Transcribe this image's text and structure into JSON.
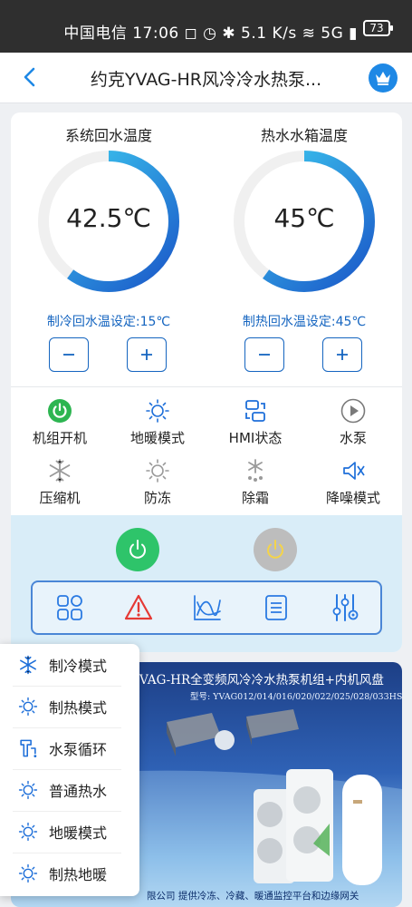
{
  "status_bar": {
    "text": "中国电信 17:06 ◻ ◷ ✱ 5.1 K/s ≋ 5G ▮",
    "battery": "73"
  },
  "header": {
    "title": "约克YVAG-HR风冷冷水热泵...",
    "back_icon": "chevron-left-icon",
    "vip_icon": "crown-icon"
  },
  "gauges": [
    {
      "label": "系统回水温度",
      "value": "42.5℃",
      "level": 0.6,
      "setpoint": "制冷回水温设定:15℃"
    },
    {
      "label": "热水水箱温度",
      "value": "45℃",
      "level": 0.6,
      "setpoint": "制热回水温设定:45℃"
    }
  ],
  "stepper": {
    "minus": "−",
    "plus": "+"
  },
  "status_items": [
    {
      "label": "机组开机",
      "icon": "power-on-icon",
      "color": "#2db551"
    },
    {
      "label": "地暖模式",
      "icon": "sun-icon",
      "color": "#1e6fd9"
    },
    {
      "label": "HMI状态",
      "icon": "hmi-icon",
      "color": "#1e6fd9"
    },
    {
      "label": "水泵",
      "icon": "play-icon",
      "color": "#7a7a7a"
    },
    {
      "label": "压缩机",
      "icon": "snowflake-icon",
      "color": "#9a9a9a"
    },
    {
      "label": "防冻",
      "icon": "sun-icon",
      "color": "#9a9a9a"
    },
    {
      "label": "除霜",
      "icon": "defrost-icon",
      "color": "#9a9a9a"
    },
    {
      "label": "降噪模式",
      "icon": "mute-icon",
      "color": "#1e6fd9"
    }
  ],
  "power_buttons": [
    {
      "icon": "power-icon",
      "color": "#2ec46a"
    },
    {
      "icon": "power-icon",
      "color": "#bdbdbd"
    }
  ],
  "toolbar": [
    {
      "icon": "grid-icon",
      "color": "#2a7ae2"
    },
    {
      "icon": "alarm-icon",
      "color": "#e53935"
    },
    {
      "icon": "trend-chart-icon",
      "color": "#2a7ae2"
    },
    {
      "icon": "list-icon",
      "color": "#2a7ae2"
    },
    {
      "icon": "sliders-icon",
      "color": "#2a7ae2"
    }
  ],
  "banner": {
    "title": "VAG-HR全变频风冷冷水热泵机组+内机风盘",
    "model": "型号: YVAG012/014/016/020/022/025/028/033HSE",
    "footer": "限公司   提供冷冻、冷藏、暖通监控平台和边缘网关"
  },
  "mode_menu": [
    {
      "label": "制冷模式",
      "icon": "snowflake-icon"
    },
    {
      "label": "制热模式",
      "icon": "sun-icon"
    },
    {
      "label": "水泵循环",
      "icon": "pump-icon"
    },
    {
      "label": "普通热水",
      "icon": "sun-icon"
    },
    {
      "label": "地暖模式",
      "icon": "sun-icon"
    },
    {
      "label": "制热地暖",
      "icon": "sun-icon"
    }
  ],
  "colors": {
    "accent": "#1e6fd9",
    "setpoint_text": "#1565c0",
    "gauge_start": "#1a56c8",
    "gauge_end": "#3fd0f2",
    "control_bg": "#d9edf8"
  }
}
